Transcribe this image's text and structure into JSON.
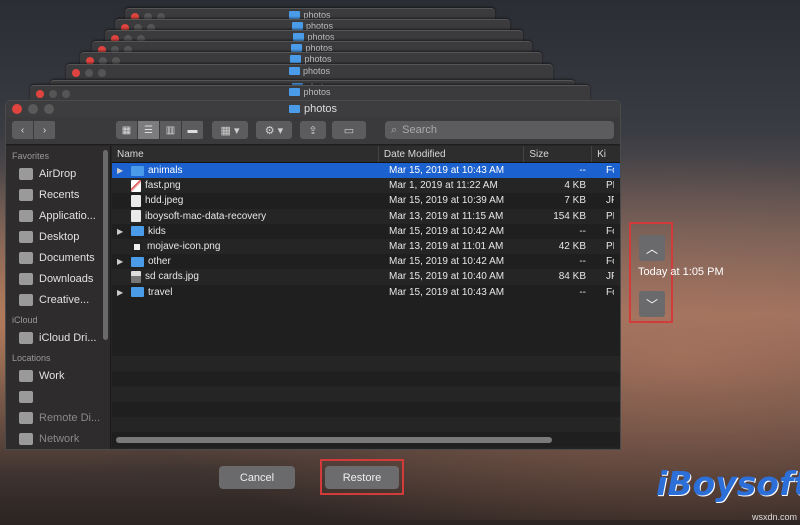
{
  "window": {
    "title": "photos",
    "stack_titles": [
      "photos",
      "photos",
      "photos",
      "photos",
      "photos",
      "photos",
      "photos",
      "photos"
    ]
  },
  "toolbar": {
    "search_placeholder": "Search",
    "back_icon": "chevron-left-icon",
    "forward_icon": "chevron-right-icon"
  },
  "sidebar": {
    "favorites_heading": "Favorites",
    "favorites": [
      {
        "label": "AirDrop",
        "icon": "airdrop-icon"
      },
      {
        "label": "Recents",
        "icon": "clock-icon"
      },
      {
        "label": "Applicatio...",
        "icon": "applications-icon"
      },
      {
        "label": "Desktop",
        "icon": "desktop-icon"
      },
      {
        "label": "Documents",
        "icon": "documents-icon"
      },
      {
        "label": "Downloads",
        "icon": "downloads-icon"
      },
      {
        "label": "Creative...",
        "icon": "folder-icon"
      }
    ],
    "icloud_heading": "iCloud",
    "icloud": [
      {
        "label": "iCloud Dri...",
        "icon": "cloud-icon"
      }
    ],
    "locations_heading": "Locations",
    "locations": [
      {
        "label": "Work",
        "icon": "computer-icon"
      },
      {
        "label": "",
        "icon": "drive-icon"
      },
      {
        "label": "Remote Di...",
        "icon": "disc-icon"
      },
      {
        "label": "Network",
        "icon": "network-icon"
      }
    ]
  },
  "columns": {
    "name": "Name",
    "date": "Date Modified",
    "size": "Size",
    "kind": "Ki"
  },
  "files": [
    {
      "name": "animals",
      "date": "Mar 15, 2019 at 10:43 AM",
      "size": "--",
      "kind": "Fo",
      "type": "folder",
      "expandable": true,
      "selected": true
    },
    {
      "name": "fast.png",
      "date": "Mar 1, 2019 at 11:22 AM",
      "size": "4 KB",
      "kind": "PN",
      "type": "img-red",
      "expandable": false,
      "selected": false
    },
    {
      "name": "hdd.jpeg",
      "date": "Mar 15, 2019 at 10:39 AM",
      "size": "7 KB",
      "kind": "JP",
      "type": "img",
      "expandable": false,
      "selected": false
    },
    {
      "name": "iboysoft-mac-data-recovery",
      "date": "Mar 13, 2019 at 11:15 AM",
      "size": "154 KB",
      "kind": "PN",
      "type": "img",
      "expandable": false,
      "selected": false
    },
    {
      "name": "kids",
      "date": "Mar 15, 2019 at 10:42 AM",
      "size": "--",
      "kind": "Fo",
      "type": "folder",
      "expandable": true,
      "selected": false
    },
    {
      "name": "mojave-icon.png",
      "date": "Mar 13, 2019 at 11:01 AM",
      "size": "42 KB",
      "kind": "PN",
      "type": "img-dark",
      "expandable": false,
      "selected": false
    },
    {
      "name": "other",
      "date": "Mar 15, 2019 at 10:42 AM",
      "size": "--",
      "kind": "Fo",
      "type": "folder",
      "expandable": true,
      "selected": false
    },
    {
      "name": "sd cards.jpg",
      "date": "Mar 15, 2019 at 10:40 AM",
      "size": "84 KB",
      "kind": "JP",
      "type": "img-sd",
      "expandable": false,
      "selected": false
    },
    {
      "name": "travel",
      "date": "Mar 15, 2019 at 10:43 AM",
      "size": "--",
      "kind": "Fo",
      "type": "folder",
      "expandable": true,
      "selected": false
    }
  ],
  "buttons": {
    "cancel": "Cancel",
    "restore": "Restore"
  },
  "timeline": {
    "label": "Today at 1:05 PM",
    "up_icon": "chevron-up-icon",
    "down_icon": "chevron-down-icon"
  },
  "branding": {
    "logo": "iBoysoft",
    "watermark": "wsxdn.com"
  },
  "colors": {
    "selection": "#1b62d0",
    "folder": "#4a9be8",
    "highlight_box": "#d33a3a",
    "brand": "#2d6fd8"
  }
}
